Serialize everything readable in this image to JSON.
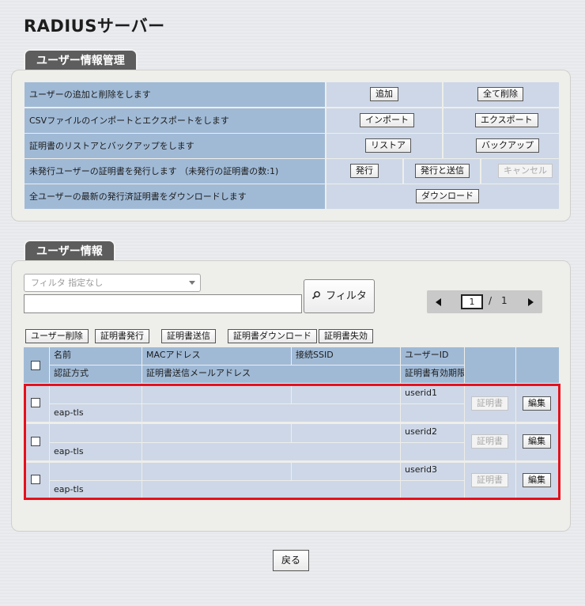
{
  "page": {
    "title": "RADIUSサーバー"
  },
  "management": {
    "tab": "ユーザー情報管理",
    "rows": [
      {
        "label": "ユーザーの追加と削除をします",
        "buttons": [
          "追加",
          "全て削除"
        ]
      },
      {
        "label": "CSVファイルのインポートとエクスポートをします",
        "buttons": [
          "インポート",
          "エクスポート"
        ]
      },
      {
        "label": "証明書のリストアとバックアップをします",
        "buttons": [
          "リストア",
          "バックアップ"
        ]
      },
      {
        "label": "未発行ユーザーの証明書を発行します （未発行の証明書の数:1)",
        "buttons": [
          "発行",
          "発行と送信",
          "キャンセル"
        ]
      },
      {
        "label": "全ユーザーの最新の発行済証明書をダウンロードします",
        "buttons": [
          "ダウンロード"
        ]
      }
    ]
  },
  "user_info": {
    "tab": "ユーザー情報",
    "filter": {
      "select_value": "フィルタ 指定なし",
      "input_value": "",
      "button": "フィルタ",
      "icon": "search-icon"
    },
    "pager": {
      "current": "1",
      "separator": "/",
      "total": "1"
    },
    "actions": [
      "ユーザー削除",
      "証明書発行",
      "証明書送信",
      "証明書ダウンロード",
      "証明書失効"
    ],
    "columns": {
      "row1": [
        "名前",
        "MACアドレス",
        "接続SSID",
        "ユーザーID"
      ],
      "row2": [
        "認証方式",
        "証明書送信メールアドレス",
        "証明書有効期限"
      ]
    },
    "users": [
      {
        "name": "",
        "mac": "",
        "ssid": "",
        "user_id": "userid1",
        "auth": "eap-tls",
        "email": "",
        "expiry": "",
        "cert_button": "証明書",
        "edit_button": "編集"
      },
      {
        "name": "",
        "mac": "",
        "ssid": "",
        "user_id": "userid2",
        "auth": "eap-tls",
        "email": "",
        "expiry": "",
        "cert_button": "証明書",
        "edit_button": "編集"
      },
      {
        "name": "",
        "mac": "",
        "ssid": "",
        "user_id": "userid3",
        "auth": "eap-tls",
        "email": "",
        "expiry": "",
        "cert_button": "証明書",
        "edit_button": "編集"
      }
    ]
  },
  "footer": {
    "back_button": "戻る"
  },
  "colors": {
    "header_cell": "#a0bad6",
    "body_cell": "#cdd7e7",
    "highlight": "#e5111c",
    "tab": "#5d5d5d"
  }
}
